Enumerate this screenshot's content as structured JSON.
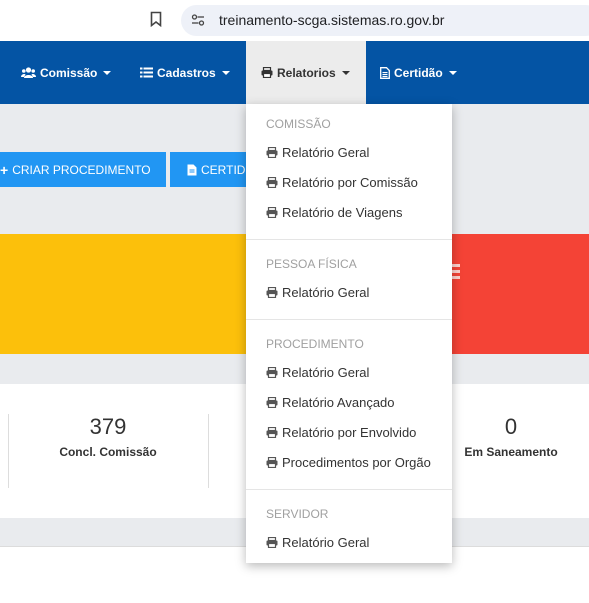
{
  "browser": {
    "url": "treinamento-scga.sistemas.ro.gov.br"
  },
  "navbar": {
    "items": [
      {
        "label": "Comissão",
        "icon": "users-icon"
      },
      {
        "label": "Cadastros",
        "icon": "list-icon"
      },
      {
        "label": "Relatorios",
        "icon": "print-icon",
        "active": true
      },
      {
        "label": "Certidão",
        "icon": "file-text-icon"
      }
    ]
  },
  "toolbar": {
    "criar_label": "CRIAR PROCEDIMENTO",
    "certidao_label": "CERTID"
  },
  "stats": [
    {
      "value": "379",
      "label": "Concl. Comissão"
    },
    {
      "value": "0",
      "label": "Em Saneamento"
    }
  ],
  "dropdown": {
    "sections": [
      {
        "header": "COMISSÃO",
        "items": [
          "Relatório Geral",
          "Relatório por Comissão",
          "Relatório de Viagens"
        ]
      },
      {
        "header": "PESSOA FÍSICA",
        "items": [
          "Relatório Geral"
        ]
      },
      {
        "header": "PROCEDIMENTO",
        "items": [
          "Relatório Geral",
          "Relatório Avançado",
          "Relatório por Envolvido",
          "Procedimentos por Orgão"
        ]
      },
      {
        "header": "SERVIDOR",
        "items": [
          "Relatório Geral"
        ]
      }
    ]
  },
  "colors": {
    "navbar": "#0454a4",
    "button": "#2196f3",
    "yellow_box": "#fcc00b",
    "red_box": "#f44336"
  }
}
